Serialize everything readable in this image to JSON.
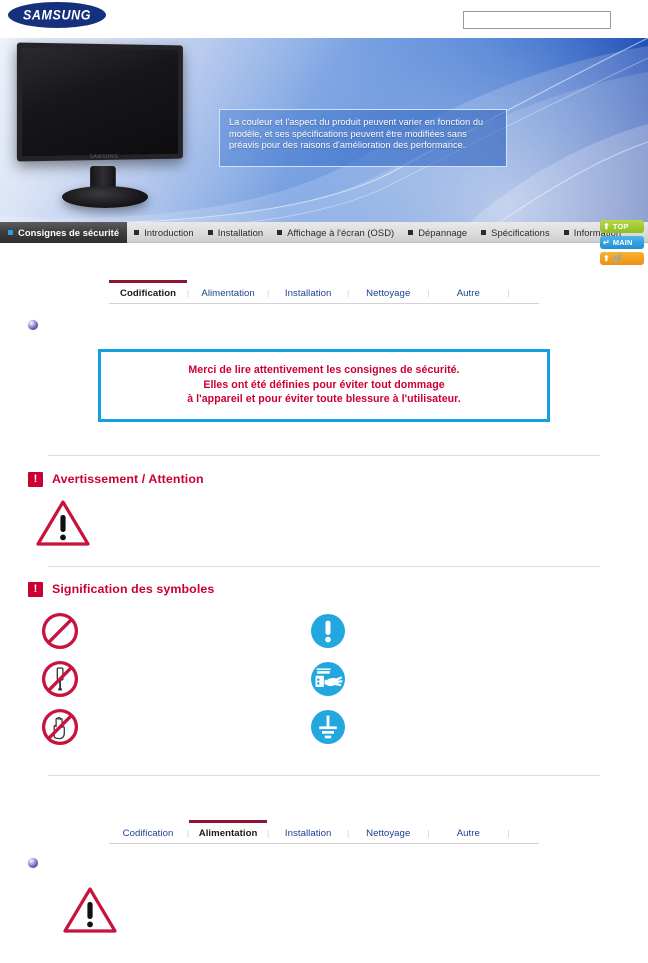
{
  "header": {
    "logo_text": "SAMSUNG",
    "search_placeholder": "",
    "search_value": ""
  },
  "hero": {
    "note_text": "La couleur et l'aspect du produit peuvent varier en fonction du modèle, et ses spécifications peuvent être modifiées sans préavis pour des raisons d'amélioration des performance.",
    "monitor_brand": "SAMSUNG"
  },
  "nav": {
    "items": [
      {
        "label": "Consignes de sécurité",
        "active": true
      },
      {
        "label": "Introduction",
        "active": false
      },
      {
        "label": "Installation",
        "active": false
      },
      {
        "label": "Affichage à l'écran (OSD)",
        "active": false
      },
      {
        "label": "Dépannage",
        "active": false
      },
      {
        "label": "Spécifications",
        "active": false
      },
      {
        "label": "Information",
        "active": false
      }
    ]
  },
  "side_buttons": [
    {
      "label": "TOP",
      "icon": "arrow-up-icon",
      "color": "#8fbf21"
    },
    {
      "label": "MAIN",
      "icon": "home-arrow-icon",
      "color": "#1f8fd0"
    },
    {
      "label": "",
      "icon": "link-icon",
      "color": "#ef8f14"
    }
  ],
  "tabs_top": {
    "items": [
      {
        "label": "Codification",
        "active": true
      },
      {
        "label": "Alimentation",
        "active": false
      },
      {
        "label": "Installation",
        "active": false
      },
      {
        "label": "Nettoyage",
        "active": false
      },
      {
        "label": "Autre",
        "active": false
      }
    ]
  },
  "tabs_bottom": {
    "items": [
      {
        "label": "Codification",
        "active": false
      },
      {
        "label": "Alimentation",
        "active": true
      },
      {
        "label": "Installation",
        "active": false
      },
      {
        "label": "Nettoyage",
        "active": false
      },
      {
        "label": "Autre",
        "active": false
      }
    ]
  },
  "notice": {
    "lines": [
      "Merci de lire attentivement les consignes de sécurité.",
      "Elles ont été définies pour éviter tout dommage",
      "à l'appareil et pour éviter toute blessure à l'utilisateur."
    ]
  },
  "sections": {
    "warning": {
      "icon_char": "!",
      "title": "Avertissement / Attention"
    },
    "symbols": {
      "icon_char": "!",
      "title": "Signification des symboles"
    }
  },
  "symbols": {
    "left": [
      {
        "name": "prohibition-icon"
      },
      {
        "name": "no-disassembly-icon"
      },
      {
        "name": "do-not-touch-icon"
      }
    ],
    "right": [
      {
        "name": "mandatory-exclamation-icon"
      },
      {
        "name": "unplug-from-outlet-icon"
      },
      {
        "name": "grounding-icon"
      }
    ]
  },
  "colors": {
    "samsung_blue": "#15317e",
    "notice_border": "#14a0e0",
    "notice_text": "#cc0033",
    "tab_link": "#1c3f94",
    "tab_active_underline": "#8c1530",
    "symbol_red": "#c8143c",
    "symbol_blue": "#22a7df"
  }
}
